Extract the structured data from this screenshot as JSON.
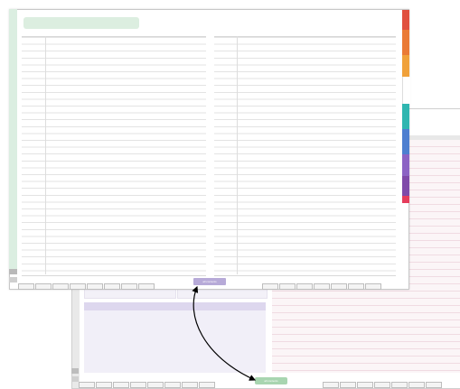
{
  "front": {
    "button_label": "all contents",
    "nav_left": [
      "",
      "",
      "",
      "",
      "",
      "",
      "",
      ""
    ],
    "nav_right": [
      "",
      "",
      "",
      "",
      "",
      "",
      "",
      "",
      ""
    ]
  },
  "back": {
    "button_label": "all contents",
    "nav_left": [
      "",
      "",
      "",
      "",
      "",
      "",
      "",
      ""
    ],
    "nav_right": [
      "",
      "",
      "",
      "",
      "",
      "",
      "",
      ""
    ]
  },
  "side_tabs": [
    {
      "label": "",
      "color": "#e0503f"
    },
    {
      "label": "",
      "color": "#ea7a35"
    },
    {
      "label": "",
      "color": "#f0a13a"
    },
    {
      "label": "",
      "color": "#ffffff"
    },
    {
      "label": "",
      "color": "#2fb6b0"
    },
    {
      "label": "",
      "color": "#4e7fd0"
    },
    {
      "label": "",
      "color": "#8c63c4"
    },
    {
      "label": "",
      "color": "#7f4aa9"
    },
    {
      "label": "",
      "color": "#e53d5c"
    }
  ],
  "colors": {
    "accent_green": "#dceee0",
    "accent_purple": "#b7aad8",
    "accent_pink": "#fbf5f7"
  }
}
